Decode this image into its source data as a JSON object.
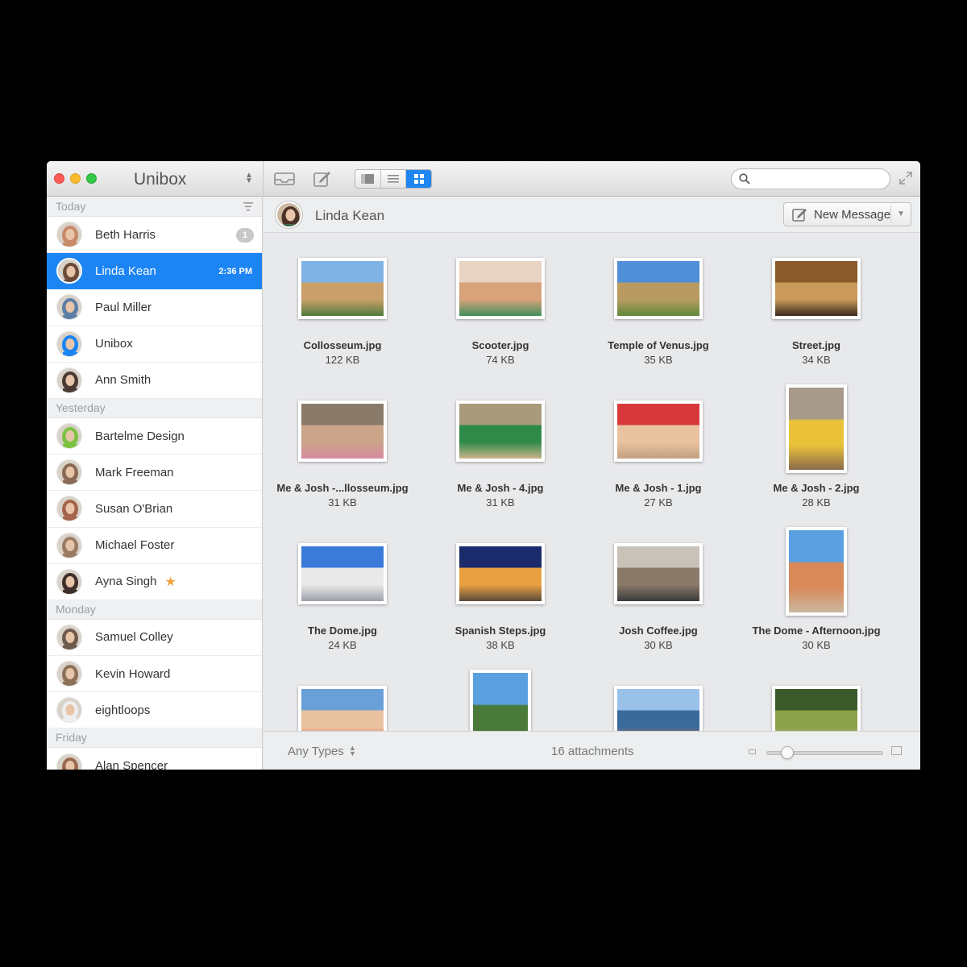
{
  "window": {
    "app_title": "Unibox",
    "accent_color": "#1d85f3"
  },
  "toolbar": {
    "icons": [
      "inbox-icon",
      "compose-icon",
      "single-view-icon",
      "list-view-icon",
      "grid-view-icon",
      "search-icon",
      "fullscreen-icon"
    ],
    "search_value": "",
    "active_view": "grid"
  },
  "sidebar": {
    "sections": [
      {
        "title": "Today",
        "contacts": [
          {
            "name": "Beth Harris",
            "badge": "1",
            "avatar_color": "#c98a6a"
          },
          {
            "name": "Linda Kean",
            "time": "2:36 PM",
            "selected": true,
            "avatar_color": "#6b4a3a"
          },
          {
            "name": "Paul Miller",
            "avatar_color": "#5e7fa5"
          },
          {
            "name": "Unibox",
            "avatar_color": "#1d85f3"
          },
          {
            "name": "Ann Smith",
            "avatar_color": "#4a3a33"
          }
        ]
      },
      {
        "title": "Yesterday",
        "contacts": [
          {
            "name": "Bartelme Design",
            "avatar_color": "#7cc242"
          },
          {
            "name": "Mark Freeman",
            "avatar_color": "#8a6a55"
          },
          {
            "name": "Susan O'Brian",
            "avatar_color": "#a4634b"
          },
          {
            "name": "Michael Foster",
            "avatar_color": "#9a7b63"
          },
          {
            "name": "Ayna Singh",
            "starred": true,
            "avatar_color": "#3f2f2a"
          }
        ]
      },
      {
        "title": "Monday",
        "contacts": [
          {
            "name": "Samuel Colley",
            "avatar_color": "#6e5a4c"
          },
          {
            "name": "Kevin Howard",
            "avatar_color": "#8c7058"
          },
          {
            "name": "eightloops",
            "avatar_color": "#eeeeee"
          }
        ]
      },
      {
        "title": "Friday",
        "contacts": [
          {
            "name": "Alan Spencer",
            "avatar_color": "#9a6a4f"
          }
        ]
      }
    ]
  },
  "conversation": {
    "contact_name": "Linda Kean",
    "new_message_label": "New Message"
  },
  "attachments": [
    {
      "name": "Collosseum.jpg",
      "size": "122 KB",
      "orientation": "landscape",
      "colors": [
        "#7fb3e6",
        "#c9a06a",
        "#4f7a3a"
      ]
    },
    {
      "name": "Scooter.jpg",
      "size": "74 KB",
      "orientation": "landscape",
      "colors": [
        "#e9d3c2",
        "#d8a27a",
        "#3f8f5a"
      ]
    },
    {
      "name": "Temple of Venus.jpg",
      "size": "35 KB",
      "orientation": "landscape",
      "colors": [
        "#4f8fd8",
        "#b99b62",
        "#5f8a3a"
      ]
    },
    {
      "name": "Street.jpg",
      "size": "34 KB",
      "orientation": "landscape",
      "colors": [
        "#8a5a2a",
        "#c99a5a",
        "#3a2a1a"
      ]
    },
    {
      "name": "Me & Josh -...llosseum.jpg",
      "size": "31 KB",
      "orientation": "landscape",
      "colors": [
        "#8a7a6a",
        "#caa58a",
        "#d88aa0"
      ]
    },
    {
      "name": "Me & Josh - 4.jpg",
      "size": "31 KB",
      "orientation": "landscape",
      "colors": [
        "#a89a7a",
        "#2f8a4a",
        "#c9b38a"
      ]
    },
    {
      "name": "Me & Josh - 1.jpg",
      "size": "27 KB",
      "orientation": "landscape",
      "colors": [
        "#d8383a",
        "#e9c2a0",
        "#c2a080"
      ]
    },
    {
      "name": "Me & Josh - 2.jpg",
      "size": "28 KB",
      "orientation": "portrait",
      "colors": [
        "#a89a8a",
        "#e9c23a",
        "#8a6a4a"
      ]
    },
    {
      "name": "The Dome.jpg",
      "size": "24 KB",
      "orientation": "landscape",
      "colors": [
        "#3a7ad8",
        "#e9e9e9",
        "#9aa0a8"
      ]
    },
    {
      "name": "Spanish Steps.jpg",
      "size": "38 KB",
      "orientation": "landscape",
      "colors": [
        "#1a2a6a",
        "#e9a040",
        "#5a4a3a"
      ]
    },
    {
      "name": "Josh Coffee.jpg",
      "size": "30 KB",
      "orientation": "landscape",
      "colors": [
        "#c9c2b8",
        "#8a7a6a",
        "#3a3a3a"
      ]
    },
    {
      "name": "The Dome - Afternoon.jpg",
      "size": "30 KB",
      "orientation": "portrait",
      "colors": [
        "#5aa0e0",
        "#d88a5a",
        "#c9b8a0"
      ]
    },
    {
      "name": "",
      "size": "",
      "orientation": "landscape",
      "colors": [
        "#6aa0d8",
        "#e9c2a0",
        "#e05a3a"
      ]
    },
    {
      "name": "",
      "size": "",
      "orientation": "portrait",
      "colors": [
        "#5aa0e0",
        "#4a7a3a",
        "#c9b8a0"
      ]
    },
    {
      "name": "",
      "size": "",
      "orientation": "landscape",
      "colors": [
        "#9ac2e9",
        "#3a6a9a",
        "#e98a5a"
      ]
    },
    {
      "name": "",
      "size": "",
      "orientation": "landscape",
      "colors": [
        "#3a5a2a",
        "#8aa04a",
        "#c9c2a0"
      ]
    }
  ],
  "footer": {
    "type_filter": "Any Types",
    "count_label": "16 attachments",
    "zoom_level": 0.18
  }
}
